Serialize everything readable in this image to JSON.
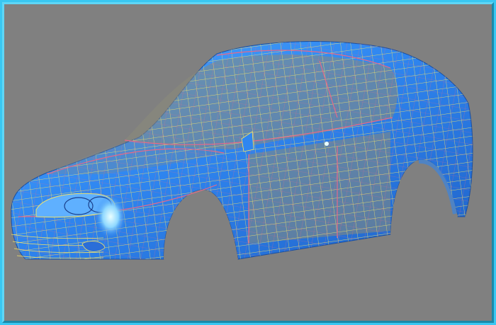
{
  "viewport": {
    "background": "#808080",
    "surface_color": "#2f86f0",
    "surface_highlight": "#9fe0ff",
    "wire_color_primary": "#f2e26a",
    "wire_color_secondary": "#e46a8a",
    "frame_color": "#39c7f2",
    "object": "car-body-wireframe-model"
  }
}
